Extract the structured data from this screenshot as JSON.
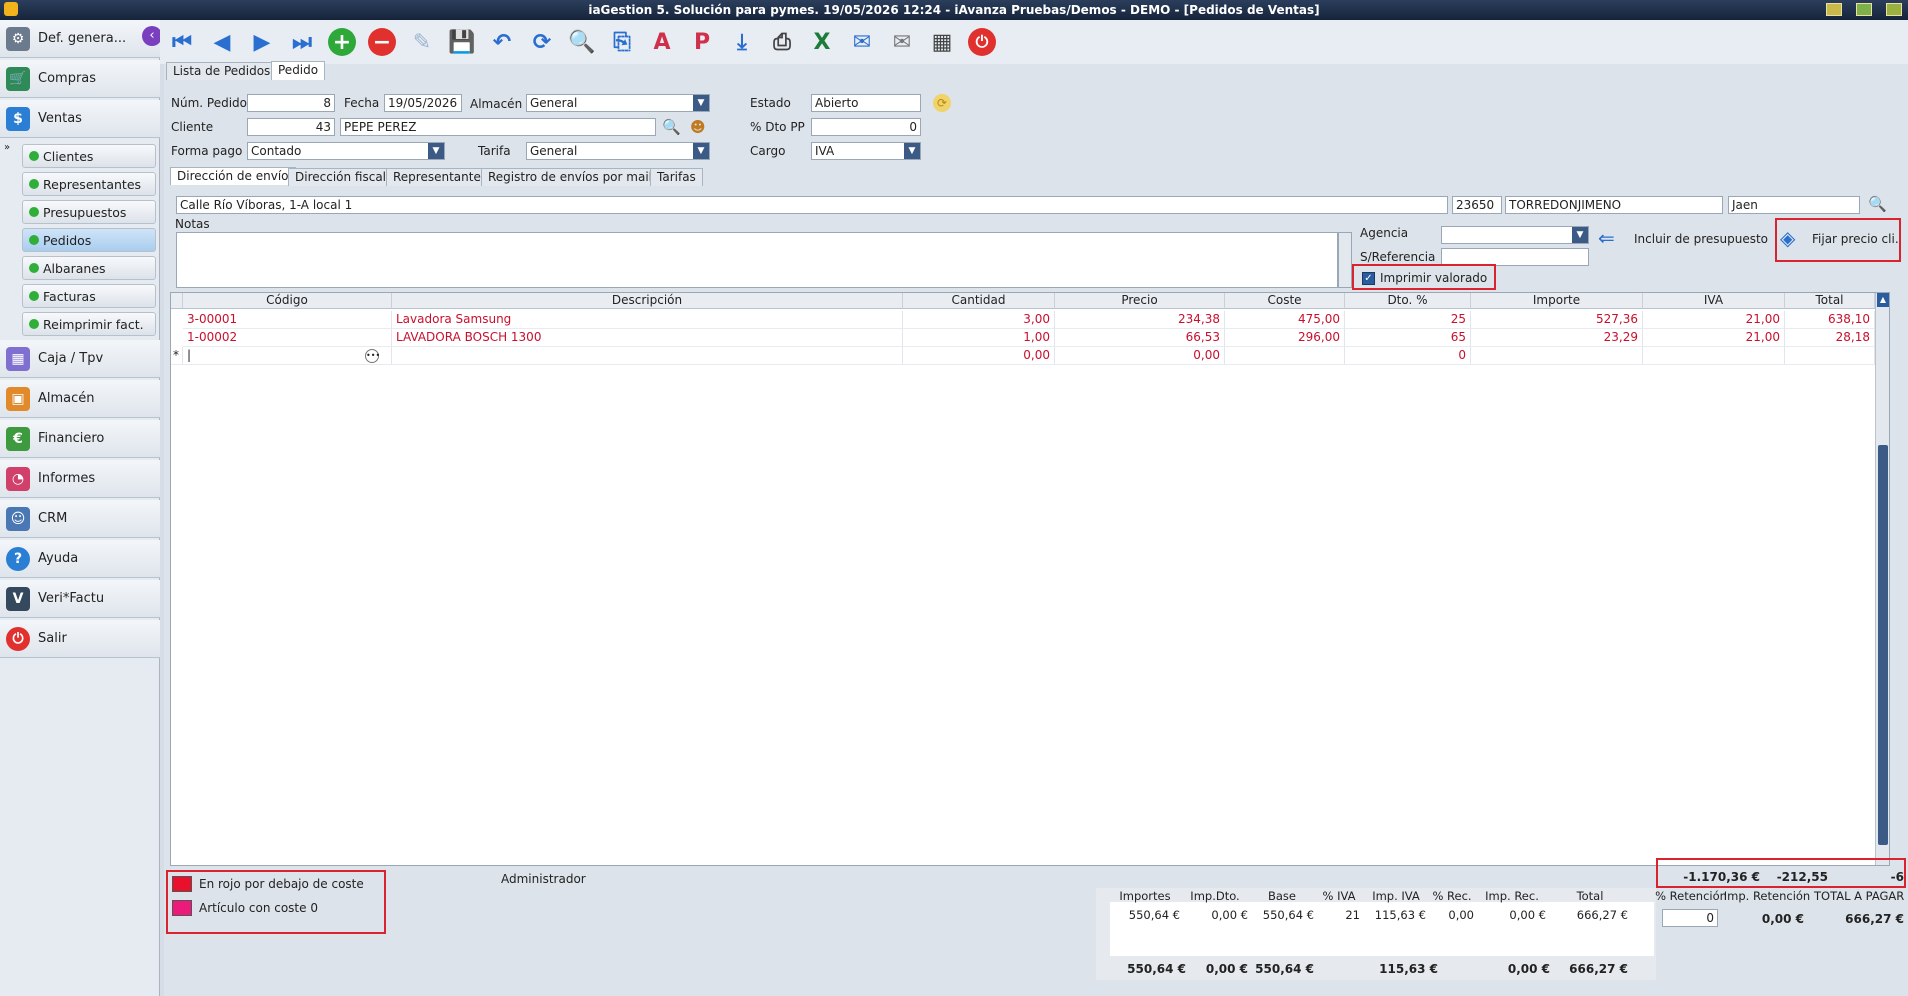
{
  "window": {
    "title": "iaGestion 5. Solución para pymes.  19/05/2026 12:24  -  iAvanza Pruebas/Demos - DEMO - [Pedidos de Ventas]"
  },
  "sidebar": {
    "header": "Def. genera...",
    "items": [
      {
        "label": "Compras",
        "icon": "cart-icon",
        "color": "#2e8b57"
      },
      {
        "label": "Ventas",
        "icon": "sales-icon",
        "color": "#2a7fd4"
      },
      {
        "label": "Caja / Tpv",
        "icon": "cash-register-icon",
        "color": "#7f6fd0"
      },
      {
        "label": "Almacén",
        "icon": "warehouse-icon",
        "color": "#e08a2b"
      },
      {
        "label": "Financiero",
        "icon": "finance-icon",
        "color": "#3e9a3e"
      },
      {
        "label": "Informes",
        "icon": "reports-icon",
        "color": "#d0406a"
      },
      {
        "label": "CRM",
        "icon": "crm-icon",
        "color": "#4a78b5"
      },
      {
        "label": "Ayuda",
        "icon": "help-icon",
        "color": "#2a7fd4"
      },
      {
        "label": "Veri*Factu",
        "icon": "verifactu-icon",
        "color": "#34495e"
      },
      {
        "label": "Salir",
        "icon": "power-icon",
        "color": "#e0312f"
      }
    ],
    "sub_items": [
      "Clientes",
      "Representantes",
      "Presupuestos",
      "Pedidos",
      "Albaranes",
      "Facturas",
      "Reimprimir fact."
    ]
  },
  "tabs": {
    "list": "Lista de Pedidos",
    "order": "Pedido"
  },
  "form": {
    "num_pedido_label": "Núm. Pedido",
    "num_pedido": "8",
    "fecha_label": "Fecha",
    "fecha": "19/05/2026",
    "almacen_label": "Almacén",
    "almacen": "General",
    "estado_label": "Estado",
    "estado": "Abierto",
    "cliente_label": "Cliente",
    "cliente_code": "43",
    "cliente_name": "PEPE PEREZ",
    "dto_pp_label": "% Dto PP",
    "dto_pp": "0",
    "forma_pago_label": "Forma pago",
    "forma_pago": "Contado",
    "tarifa_label": "Tarifa",
    "tarifa": "General",
    "cargo_label": "Cargo",
    "cargo": "IVA"
  },
  "subtabs": [
    "Dirección de envío",
    "Dirección fiscal",
    "Representante",
    "Registro de envíos por mail",
    "Tarifas"
  ],
  "address": {
    "street": "Calle Río Víboras, 1-A local 1",
    "zip": "23650",
    "city": "TORREDONJIMENO",
    "province": "Jaen"
  },
  "notes_label": "Notas",
  "extra": {
    "agencia_label": "Agencia",
    "sref_label": "S/Referencia",
    "imprimir_label": "Imprimir valorado",
    "incluir_label": "Incluir de presupuesto",
    "fijar_label": "Fijar precio cli."
  },
  "grid": {
    "columns": [
      "Código",
      "Descripción",
      "Cantidad",
      "Precio",
      "Coste",
      "Dto. %",
      "Importe",
      "IVA",
      "Total"
    ],
    "rows": [
      [
        "3-00001",
        "Lavadora Samsung",
        "3,00",
        "234,38",
        "475,00",
        "25",
        "527,36",
        "21,00",
        "638,10"
      ],
      [
        "1-00002",
        "LAVADORA BOSCH 1300",
        "1,00",
        "66,53",
        "296,00",
        "65",
        "23,29",
        "21,00",
        "28,18"
      ],
      [
        "",
        "",
        "0,00",
        "0,00",
        "",
        "0",
        "",
        "",
        ""
      ]
    ],
    "new_row_marker": "*"
  },
  "legend": [
    {
      "label": "En rojo por debajo de coste",
      "color": "#e8102a"
    },
    {
      "label": "Artículo con coste 0",
      "color": "#ec1a7a"
    }
  ],
  "user": "Administrador",
  "margins": {
    "v1": "-1.170,36 €",
    "v2": "-212,55",
    "v3": "-6"
  },
  "totals": {
    "headers": [
      "Importes",
      "Imp.Dto.",
      "Base",
      "% IVA",
      "Imp. IVA",
      "% Rec.",
      "Imp. Rec.",
      "Total"
    ],
    "row": [
      "550,64 €",
      "0,00 €",
      "550,64 €",
      "21",
      "115,63 €",
      "0,00",
      "0,00 €",
      "666,27 €"
    ],
    "footer": [
      "550,64 €",
      "0,00 €",
      "550,64 €",
      "",
      "115,63 €",
      "",
      "0,00 €",
      "666,27 €"
    ],
    "retencion_label": "% Retención",
    "retencion": "0",
    "imp_ret_label": "Imp. Retención",
    "imp_ret": "0,00 €",
    "total_pagar_label": "TOTAL A PAGAR",
    "total_pagar": "666,27 €"
  }
}
